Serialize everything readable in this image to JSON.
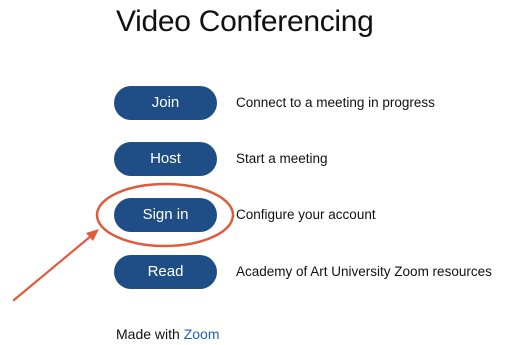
{
  "page": {
    "title": "Video Conferencing"
  },
  "actions": [
    {
      "label": "Join",
      "description": "Connect to a meeting in progress"
    },
    {
      "label": "Host",
      "description": "Start a meeting"
    },
    {
      "label": "Sign in",
      "description": "Configure your account"
    },
    {
      "label": "Read",
      "description": "Academy of Art University Zoom resources"
    }
  ],
  "footer": {
    "prefix": "Made with",
    "link_label": "Zoom"
  },
  "colors": {
    "button_bg": "#1f4e86",
    "button_text": "#ffffff",
    "annotation": "#e05a3c",
    "link": "#1f5fbf"
  }
}
